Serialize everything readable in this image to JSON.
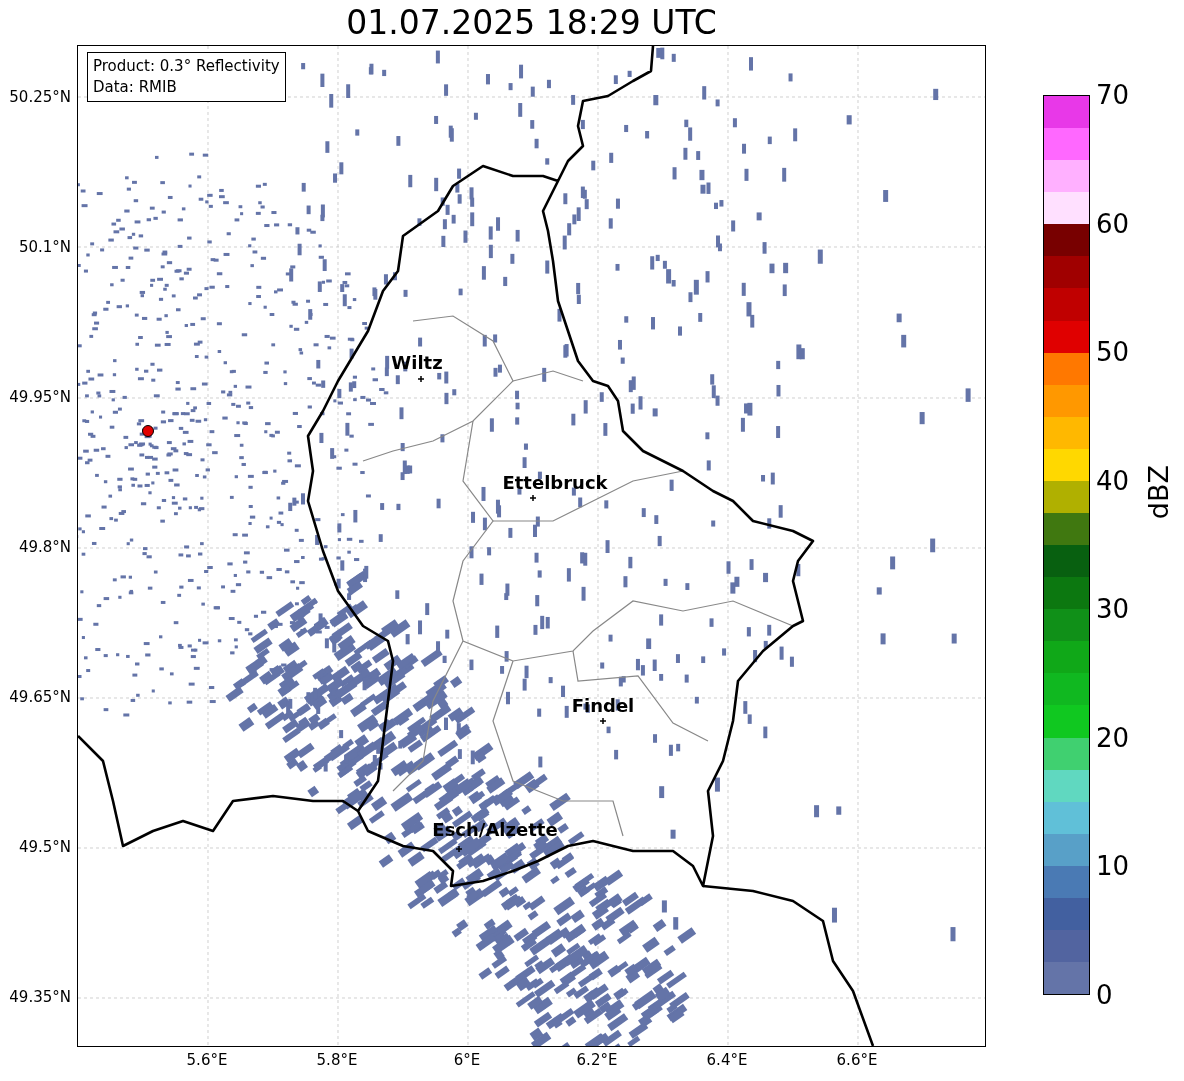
{
  "title": "01.07.2025 18:29 UTC",
  "info_box": [
    "Product: 0.3° Reflectivity",
    "Data: RMIB"
  ],
  "map": {
    "y_ticks": [
      "50.25°N",
      "50.1°N",
      "49.95°N",
      "49.8°N",
      "49.65°N",
      "49.5°N",
      "49.35°N"
    ],
    "x_ticks": [
      "5.6°E",
      "5.8°E",
      "6°E",
      "6.2°E",
      "6.4°E",
      "6.6°E"
    ],
    "places": [
      {
        "name": "Wiltz"
      },
      {
        "name": "Ettelbruck"
      },
      {
        "name": "Findel"
      },
      {
        "name": "Esch/Alzette"
      }
    ]
  },
  "colorbar": {
    "label": "dBZ",
    "ticks": [
      "70",
      "60",
      "50",
      "40",
      "30",
      "20",
      "10",
      "0"
    ],
    "segments": [
      {
        "color": "#e838e8"
      },
      {
        "color": "#ff68ff"
      },
      {
        "color": "#ffb0ff"
      },
      {
        "color": "#ffe0ff"
      },
      {
        "color": "#780000"
      },
      {
        "color": "#a00000"
      },
      {
        "color": "#c00000"
      },
      {
        "color": "#e00000"
      },
      {
        "color": "#ff7800"
      },
      {
        "color": "#ff9800"
      },
      {
        "color": "#ffb800"
      },
      {
        "color": "#ffd800"
      },
      {
        "color": "#b0b000"
      },
      {
        "color": "#407810"
      },
      {
        "color": "#086010"
      },
      {
        "color": "#0c7810"
      },
      {
        "color": "#109018"
      },
      {
        "color": "#10a818"
      },
      {
        "color": "#10b820"
      },
      {
        "color": "#10c820"
      },
      {
        "color": "#40d070"
      },
      {
        "color": "#60d8c0"
      },
      {
        "color": "#60c0d8"
      },
      {
        "color": "#58a0c8"
      },
      {
        "color": "#4a7ab4"
      },
      {
        "color": "#4260a0"
      },
      {
        "color": "#5264a0"
      },
      {
        "color": "#6474a8"
      }
    ]
  }
}
